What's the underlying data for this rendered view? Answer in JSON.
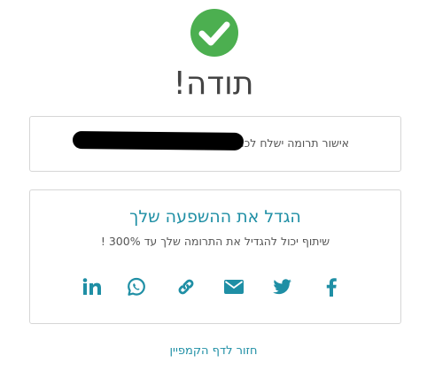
{
  "status_icon": "check-circle-icon",
  "accent_color": "#1f8fa5",
  "success_color": "#4caf50",
  "title": "תודה!",
  "confirmation": {
    "text": "אישור תרומה ישלח לכתובת"
  },
  "share": {
    "heading": "הגדל את ההשפעה שלך",
    "subtext": "שיתוף יכול להגדיל את התרומה שלך עד 300% !",
    "icons": [
      "linkedin-icon",
      "whatsapp-icon",
      "link-icon",
      "email-icon",
      "twitter-icon",
      "facebook-icon"
    ]
  },
  "back_link": "חזור לדף הקמפיין"
}
